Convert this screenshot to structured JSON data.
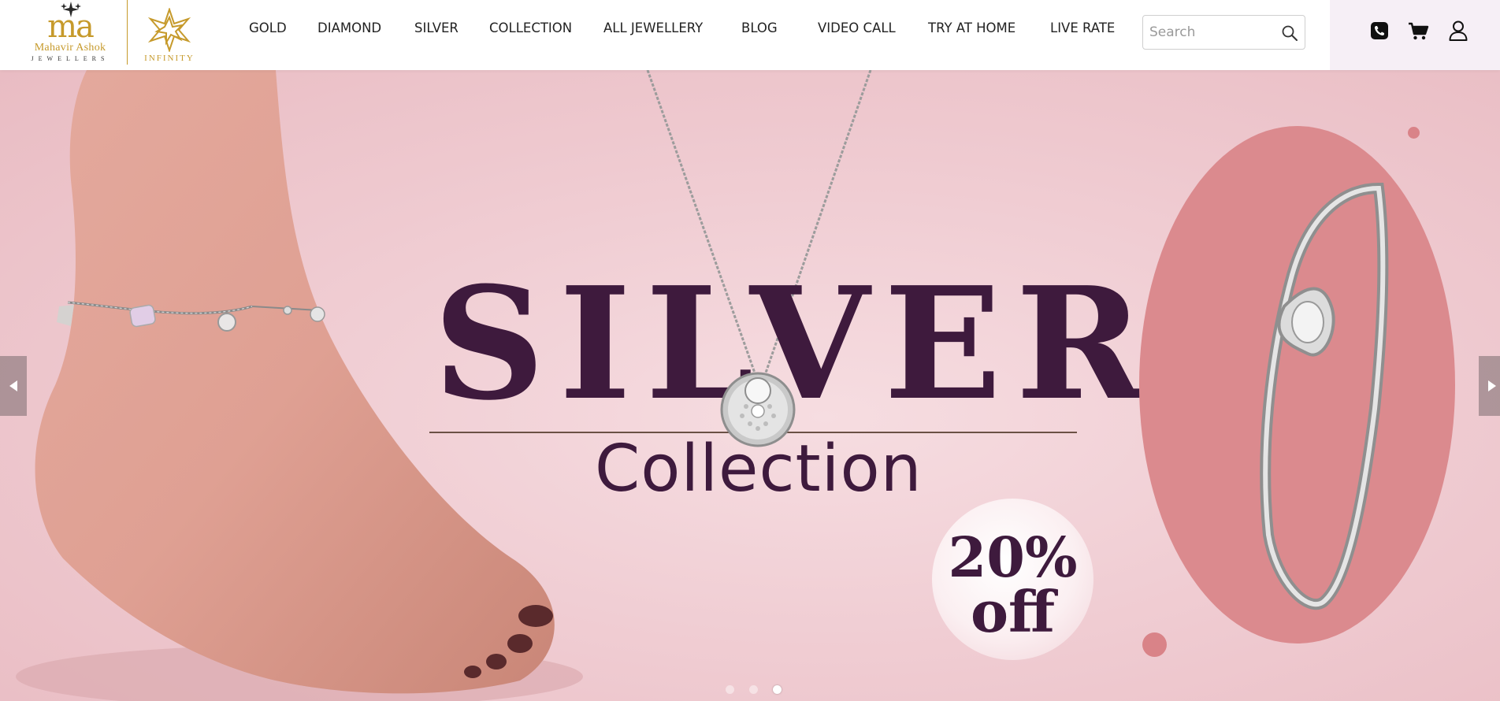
{
  "brand": {
    "monogram": "ma",
    "name": "Mahavir Ashok",
    "tagline": "JEWELLERS",
    "sub_brand": "INFINITY",
    "color": "#c69a2b"
  },
  "nav": {
    "items": [
      {
        "label": "GOLD"
      },
      {
        "label": "DIAMOND"
      },
      {
        "label": "SILVER"
      },
      {
        "label": "COLLECTION"
      },
      {
        "label": "ALL JEWELLERY"
      },
      {
        "label": "BLOG"
      },
      {
        "label": "VIDEO CALL"
      },
      {
        "label": "TRY AT HOME"
      },
      {
        "label": "LIVE RATE"
      }
    ]
  },
  "search": {
    "placeholder": "Search",
    "value": "",
    "icon": "search-icon"
  },
  "header_icons": [
    {
      "name": "phone-icon"
    },
    {
      "name": "cart-icon"
    },
    {
      "name": "user-icon"
    }
  ],
  "hero": {
    "headline": "SILVER",
    "subheadline": "Collection",
    "offer_percent": "20%",
    "offer_label": "off",
    "text_color": "#3e1a3d",
    "accent_color": "#db8a8e",
    "slides_total": 3,
    "active_slide": 3
  }
}
